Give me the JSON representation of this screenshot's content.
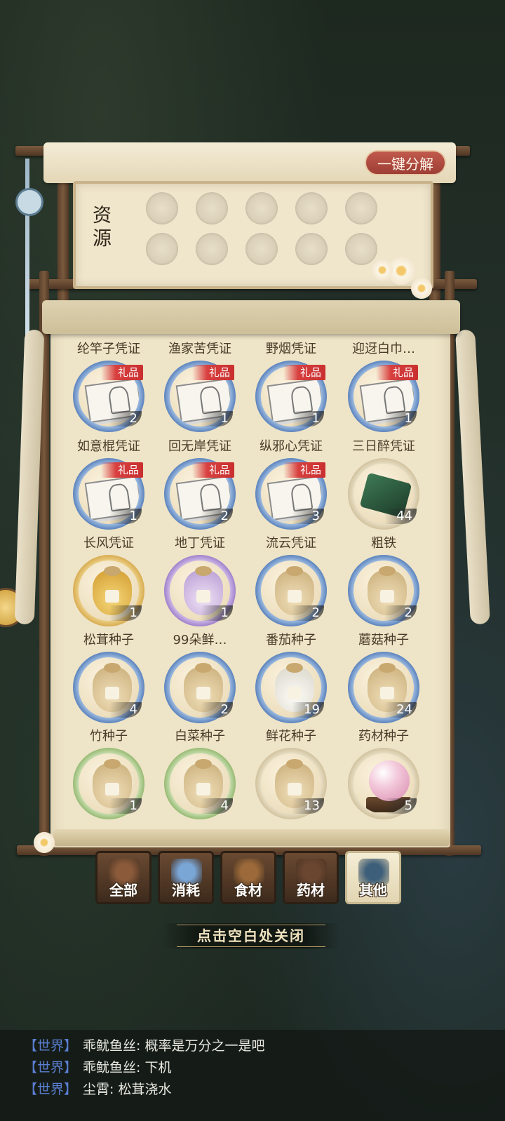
{
  "header": {
    "onekey_label": "一键分解",
    "title": "资源"
  },
  "items": [
    {
      "name": "纶竿子凭证",
      "count": "2",
      "badge": "礼品",
      "kind": "doc",
      "ring": "blue"
    },
    {
      "name": "渔家苦凭证",
      "count": "1",
      "badge": "礼品",
      "kind": "doc",
      "ring": "blue"
    },
    {
      "name": "野烟凭证",
      "count": "1",
      "badge": "礼品",
      "kind": "doc",
      "ring": "blue"
    },
    {
      "name": "迎迓白巾…",
      "count": "1",
      "badge": "礼品",
      "kind": "doc",
      "ring": "blue"
    },
    {
      "name": "如意棍凭证",
      "count": "1",
      "badge": "礼品",
      "kind": "doc",
      "ring": "blue"
    },
    {
      "name": "回无岸凭证",
      "count": "2",
      "badge": "礼品",
      "kind": "doc",
      "ring": "blue"
    },
    {
      "name": "纵邪心凭证",
      "count": "3",
      "badge": "礼品",
      "kind": "doc",
      "ring": "blue"
    },
    {
      "name": "三日醉凭证",
      "count": "44",
      "badge": "",
      "kind": "ore",
      "ring": "plain"
    },
    {
      "name": "长风凭证",
      "count": "1",
      "badge": "",
      "kind": "bag-gold",
      "ring": "gold"
    },
    {
      "name": "地丁凭证",
      "count": "1",
      "badge": "",
      "kind": "bag-purple",
      "ring": "purple"
    },
    {
      "name": "流云凭证",
      "count": "2",
      "badge": "",
      "kind": "bag",
      "ring": "blue"
    },
    {
      "name": "粗铁",
      "count": "2",
      "badge": "",
      "kind": "bag",
      "ring": "blue"
    },
    {
      "name": "松茸种子",
      "count": "4",
      "badge": "",
      "kind": "bag",
      "ring": "blue"
    },
    {
      "name": "99朵鲜…",
      "count": "2",
      "badge": "",
      "kind": "bag",
      "ring": "blue"
    },
    {
      "name": "番茄种子",
      "count": "19",
      "badge": "",
      "kind": "bag-white",
      "ring": "blue"
    },
    {
      "name": "蘑菇种子",
      "count": "24",
      "badge": "",
      "kind": "bag",
      "ring": "blue"
    },
    {
      "name": "竹种子",
      "count": "1",
      "badge": "",
      "kind": "bag",
      "ring": "green"
    },
    {
      "name": "白菜种子",
      "count": "4",
      "badge": "",
      "kind": "bag",
      "ring": "green"
    },
    {
      "name": "鲜花种子",
      "count": "13",
      "badge": "",
      "kind": "bag",
      "ring": "plain"
    },
    {
      "name": "药材种子",
      "count": "5",
      "badge": "",
      "kind": "orb",
      "ring": "plain"
    }
  ],
  "tabs": [
    {
      "label": "全部",
      "icon": "chest-icon",
      "active": false,
      "color": "#8a5a3a"
    },
    {
      "label": "消耗",
      "icon": "potion-icon",
      "active": false,
      "color": "#7aa6d6"
    },
    {
      "label": "食材",
      "icon": "vegetables-icon",
      "active": false,
      "color": "#9c6a3a"
    },
    {
      "label": "药材",
      "icon": "teapot-icon",
      "active": false,
      "color": "#6a4630"
    },
    {
      "label": "其他",
      "icon": "pot-icon",
      "active": true,
      "color": "#3e5f7a"
    }
  ],
  "close_hint": "点击空白处关闭",
  "chat": [
    {
      "channel": "【世界】",
      "text": "乖鱿鱼丝: 概率是万分之一是吧"
    },
    {
      "channel": "【世界】",
      "text": "乖鱿鱼丝: 下机"
    },
    {
      "channel": "【世界】",
      "text": "尘霄: 松茸浇水"
    }
  ]
}
